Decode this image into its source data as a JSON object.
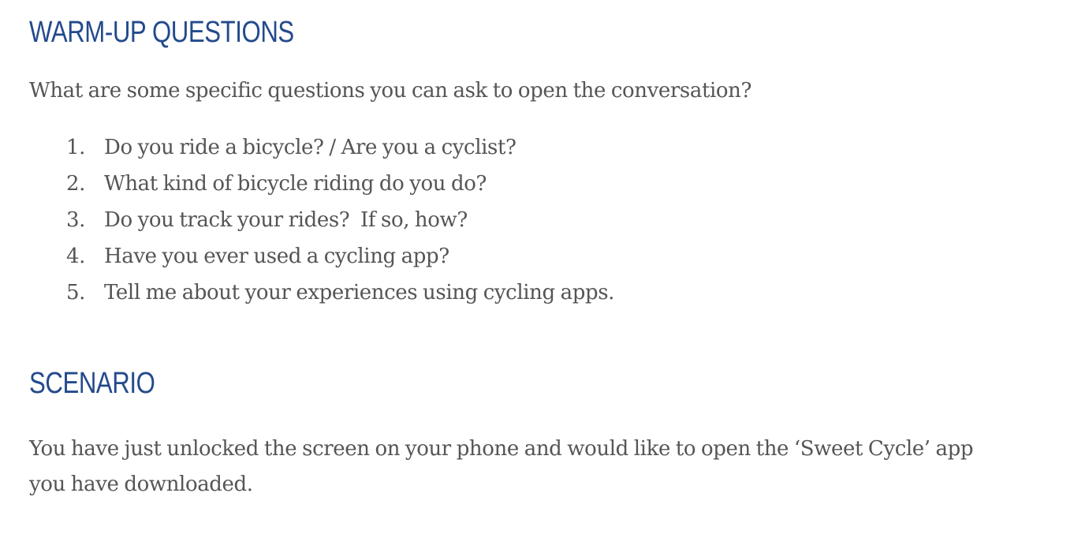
{
  "warmup": {
    "heading": "WARM-UP QUESTIONS",
    "intro": "What are some specific questions you can ask to open the conversation?",
    "questions": [
      {
        "number": "1.",
        "text": "Do you ride a bicycle? / Are you a cyclist?"
      },
      {
        "number": "2.",
        "text": "What kind of bicycle riding do you do?"
      },
      {
        "number": "3.",
        "text": "Do you track your rides?  If so, how?"
      },
      {
        "number": "4.",
        "text": "Have you ever used a cycling app?"
      },
      {
        "number": "5.",
        "text": "Tell me about your experiences using cycling apps."
      }
    ]
  },
  "scenario": {
    "heading": "SCENARIO",
    "text": "You have just unlocked the screen on your phone and would like to open the ‘Sweet Cycle’ app you have downloaded."
  },
  "colors": {
    "heading": "#234a8c",
    "body_text": "#555555",
    "background": "#ffffff"
  }
}
